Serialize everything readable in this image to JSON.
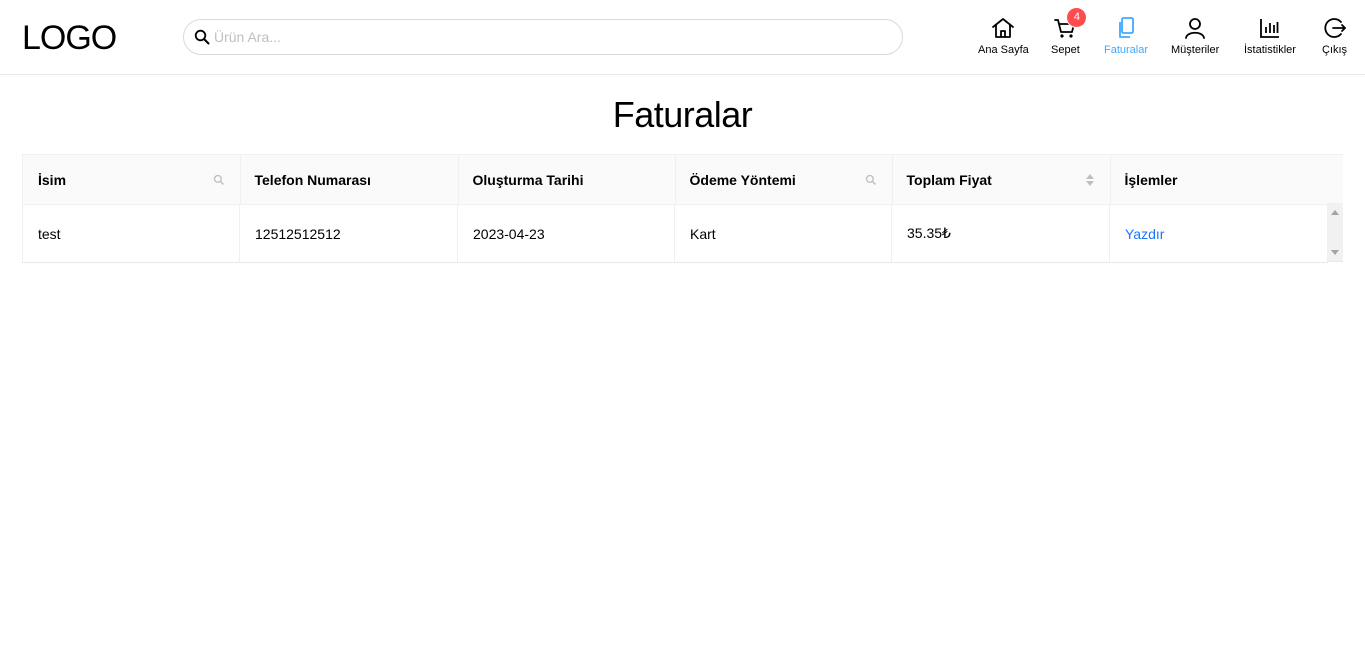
{
  "header": {
    "logo": "LOGO",
    "search": {
      "placeholder": "Ürün Ara..."
    },
    "cart_count": "4",
    "nav": [
      {
        "label": "Ana Sayfa",
        "icon": "home-icon",
        "active": false
      },
      {
        "label": "Sepet",
        "icon": "cart-icon",
        "active": false
      },
      {
        "label": "Faturalar",
        "icon": "invoice-icon",
        "active": true
      },
      {
        "label": "Müşteriler",
        "icon": "user-icon",
        "active": false
      },
      {
        "label": "İstatistikler",
        "icon": "bar-chart-icon",
        "active": false
      },
      {
        "label": "Çıkış",
        "icon": "logout-icon",
        "active": false
      }
    ],
    "accent_color": "#40a9ff"
  },
  "page_title": "Faturalar",
  "table": {
    "columns": [
      "İsim",
      "Telefon Numarası",
      "Oluşturma Tarihi",
      "Ödeme Yöntemi",
      "Toplam Fiyat",
      "İşlemler"
    ],
    "rows": [
      {
        "name": "test",
        "phone": "12512512512",
        "date": "2023-04-23",
        "payment": "Kart",
        "total": "35.35₺",
        "action": "Yazdır"
      }
    ]
  },
  "colors": {
    "link": "#1677ff",
    "badge": "#ff4d4f"
  }
}
